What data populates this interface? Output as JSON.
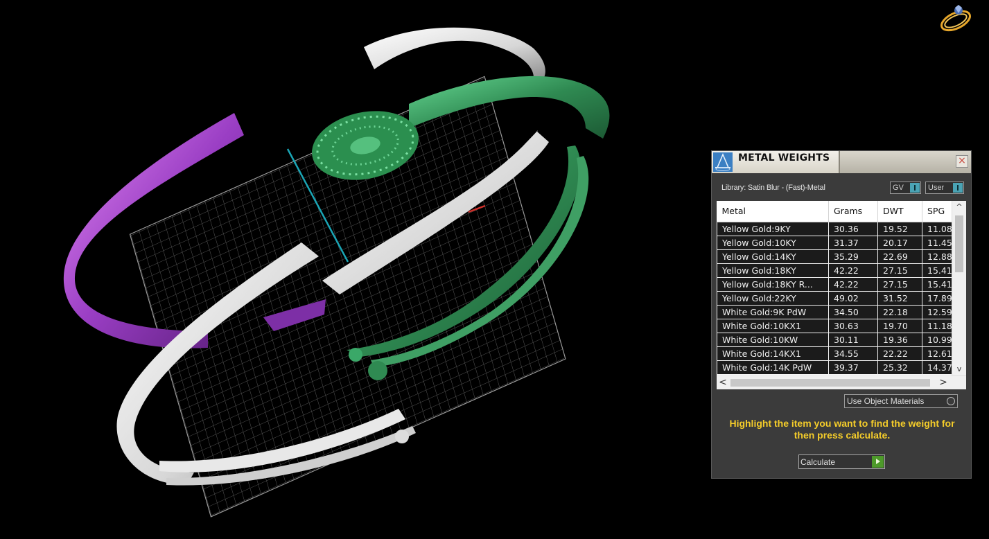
{
  "panel": {
    "title": "METAL WEIGHTS",
    "close_glyph": "×",
    "library_label": "Library: Satin Blur - (Fast)-Metal",
    "toggles": {
      "gv": "GV",
      "user": "User"
    },
    "columns": [
      "Metal",
      "Grams",
      "DWT",
      "SPG"
    ],
    "rows": [
      [
        "Yellow Gold:9KY",
        "30.36",
        "19.52",
        "11.08"
      ],
      [
        "Yellow Gold:10KY",
        "31.37",
        "20.17",
        "11.45"
      ],
      [
        "Yellow Gold:14KY",
        "35.29",
        "22.69",
        "12.88"
      ],
      [
        "Yellow Gold:18KY",
        "42.22",
        "27.15",
        "15.41"
      ],
      [
        "Yellow Gold:18KY R...",
        "42.22",
        "27.15",
        "15.41"
      ],
      [
        "Yellow Gold:22KY",
        "49.02",
        "31.52",
        "17.89"
      ],
      [
        "White Gold:9K PdW",
        "34.50",
        "22.18",
        "12.59"
      ],
      [
        "White Gold:10KX1",
        "30.63",
        "19.70",
        "11.18"
      ],
      [
        "White Gold:10KW",
        "30.11",
        "19.36",
        "10.99"
      ],
      [
        "White Gold:14KX1",
        "34.55",
        "22.22",
        "12.61"
      ],
      [
        "White Gold:14K PdW",
        "39.37",
        "25.32",
        "14.37"
      ]
    ],
    "scroll": {
      "up": "^",
      "down": "v",
      "left": "<",
      "right": ">"
    },
    "use_object_materials_label": "Use Object Materials",
    "hint": "Highlight the item you want to find the weight for then press calculate.",
    "calculate_label": "Calculate"
  },
  "icons": {
    "logo": "ring-logo-icon",
    "panel": "metal-weights-panel-icon",
    "close": "close-icon",
    "go": "play-arrow-icon"
  },
  "colors": {
    "background": "#000000",
    "hint_text": "#f5cd2a",
    "toggle_knob": "#4aa3b4",
    "calculate_go": "#4d9a2a",
    "band_purple": "#b24fd6",
    "band_green": "#3c9a5c",
    "band_white": "#e6e6e6",
    "axis_cyan": "#1aa5b5"
  }
}
